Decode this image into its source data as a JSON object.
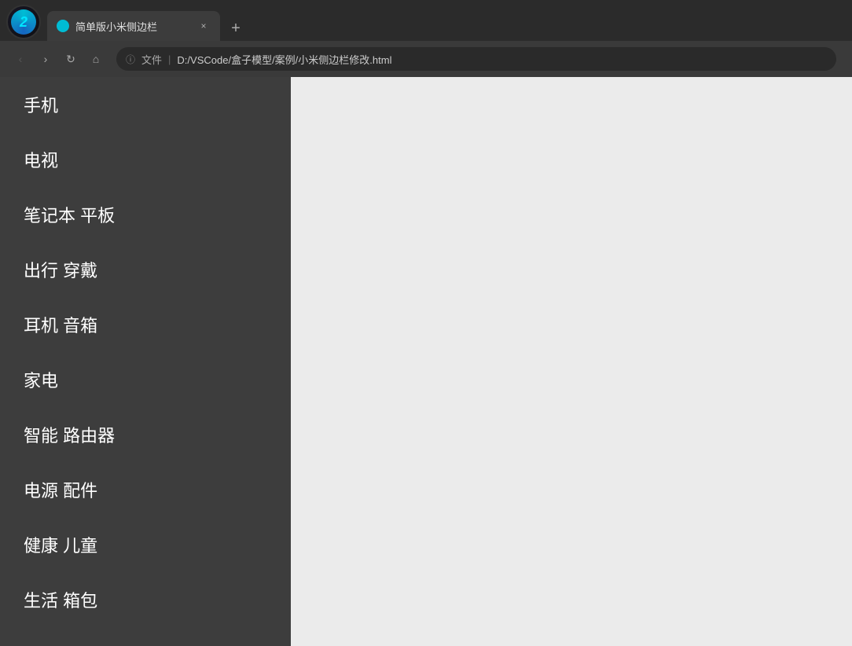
{
  "browser": {
    "tab_title": "简单版小米侧边栏",
    "tab_favicon": "●",
    "new_tab_label": "+",
    "close_tab_label": "×",
    "nav": {
      "back_label": "‹",
      "forward_label": "›",
      "reload_label": "↻",
      "home_label": "⌂",
      "file_label": "文件",
      "address": "D:/VSCode/盒子模型/案例/小米侧边栏修改.html",
      "info_icon": "ⓘ",
      "separator": "|"
    }
  },
  "sidebar": {
    "items": [
      {
        "label": "手机"
      },
      {
        "label": "电视"
      },
      {
        "label": "笔记本 平板"
      },
      {
        "label": "出行 穿戴"
      },
      {
        "label": "耳机 音箱"
      },
      {
        "label": "家电"
      },
      {
        "label": "智能 路由器"
      },
      {
        "label": "电源 配件"
      },
      {
        "label": "健康 儿童"
      },
      {
        "label": "生活 箱包"
      }
    ]
  }
}
